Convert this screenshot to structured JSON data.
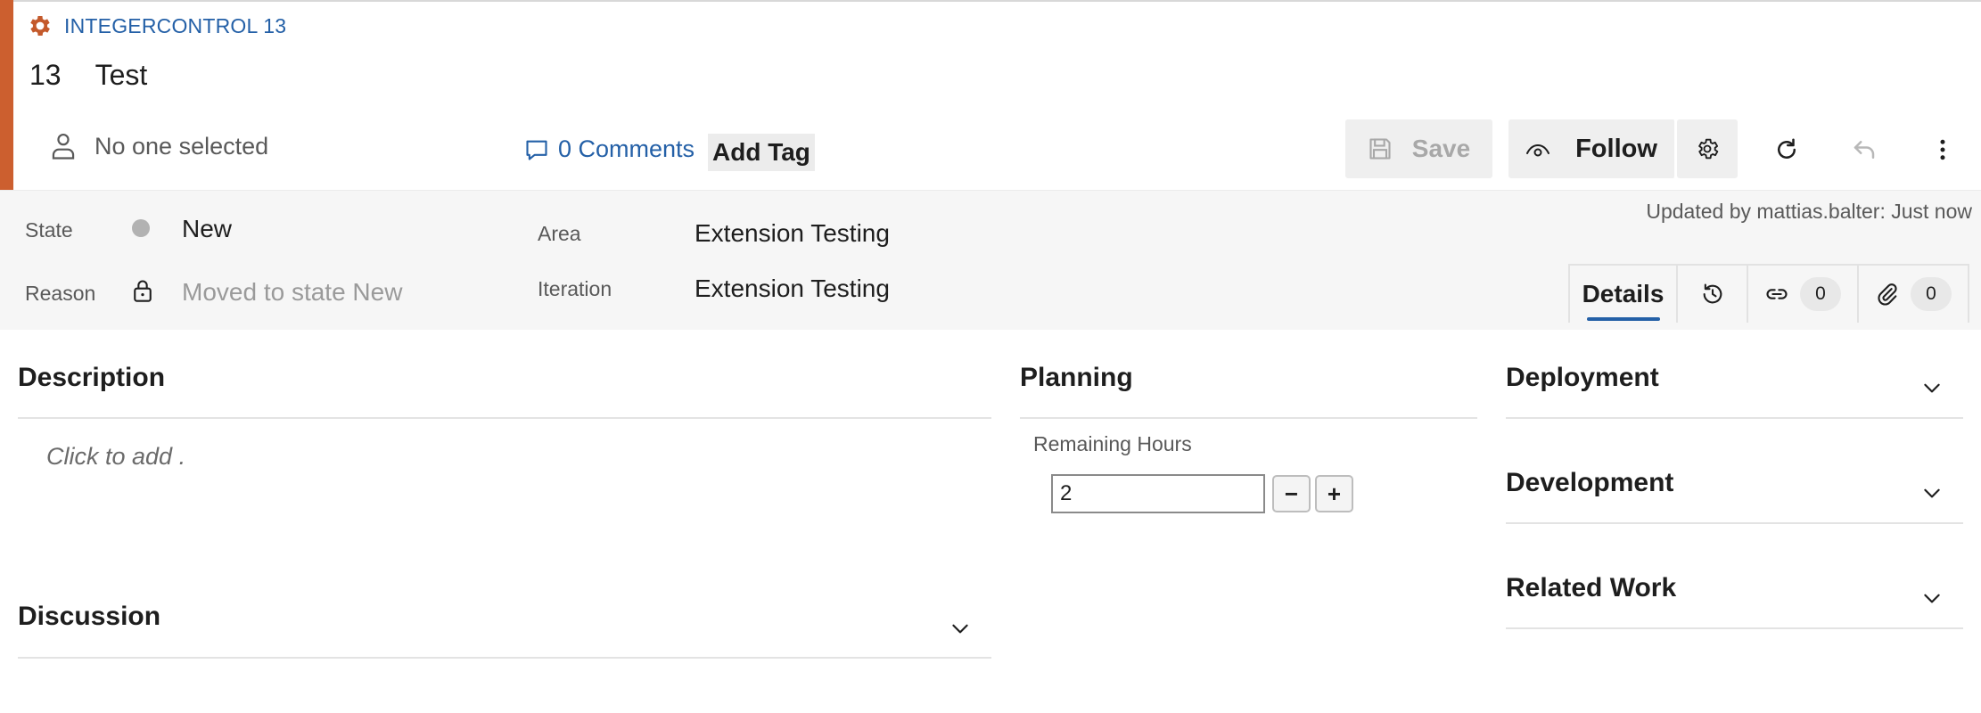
{
  "work_item": {
    "type_label": "INTEGERCONTROL 13",
    "id": "13",
    "title": "Test",
    "accent_color": "#cc5f2f"
  },
  "header": {
    "assignee": "No one selected",
    "comments_label": "0 Comments",
    "add_tag_label": "Add Tag",
    "save_label": "Save",
    "follow_label": "Follow",
    "icons": [
      "gear-icon",
      "person-icon",
      "comment-icon",
      "save-icon",
      "eye-icon",
      "refresh-icon",
      "undo-icon",
      "more-vertical-icon"
    ]
  },
  "fields": {
    "state_label": "State",
    "state_value": "New",
    "state_color": "#b2b2b2",
    "reason_label": "Reason",
    "reason_value": "Moved to state New",
    "area_label": "Area",
    "area_value": "Extension Testing",
    "iteration_label": "Iteration",
    "iteration_value": "Extension Testing",
    "updated_text": "Updated by mattias.balter: Just now"
  },
  "tabs": {
    "details_label": "Details",
    "links_count": "0",
    "attachments_count": "0"
  },
  "sections": {
    "description_title": "Description",
    "description_placeholder": "Click to add .",
    "discussion_title": "Discussion",
    "planning_title": "Planning",
    "remaining_hours_label": "Remaining Hours",
    "remaining_hours_value": "2",
    "decrement_label": "−",
    "increment_label": "+",
    "deployment_title": "Deployment",
    "development_title": "Development",
    "related_work_title": "Related Work"
  }
}
